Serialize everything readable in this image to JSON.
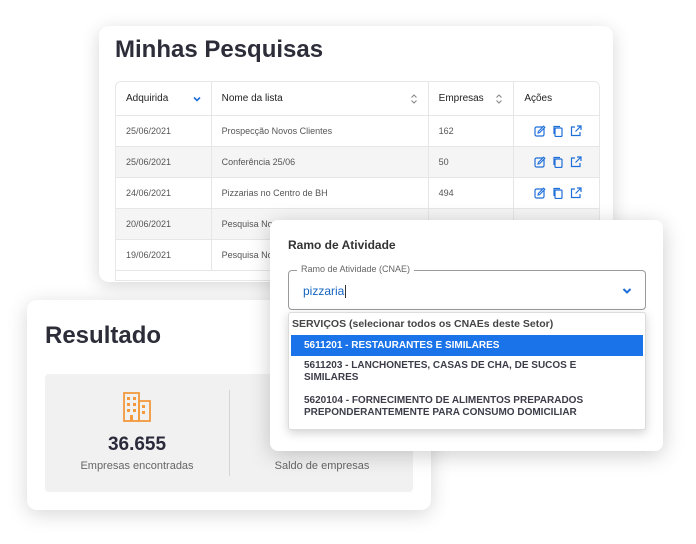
{
  "pesquisas": {
    "title": "Minhas Pesquisas",
    "columns": {
      "adquirida": "Adquirida",
      "nome": "Nome da lista",
      "empresas": "Empresas",
      "acoes": "Ações"
    },
    "rows": [
      {
        "date": "25/06/2021",
        "name": "Prospecção Novos Clientes",
        "count": "162"
      },
      {
        "date": "25/06/2021",
        "name": "Conferência 25/06",
        "count": "50"
      },
      {
        "date": "24/06/2021",
        "name": "Pizzarias no Centro de BH",
        "count": "494"
      },
      {
        "date": "20/06/2021",
        "name": "Pesquisa No",
        "count": ""
      },
      {
        "date": "19/06/2021",
        "name": "Pesquisa No",
        "count": ""
      }
    ],
    "action_icons": [
      "edit-icon",
      "copy-icon",
      "open-external-icon"
    ]
  },
  "resultado": {
    "title": "Resultado",
    "left_stat": {
      "value": "36.655",
      "label": "Empresas encontradas",
      "icon": "building-icon"
    },
    "right_stat": {
      "value": "",
      "label": "Saldo de empresas"
    }
  },
  "ramo": {
    "title": "Ramo de Atividade",
    "field_label": "Ramo de Atividade (CNAE)",
    "field_value": "pizzaria",
    "group_label": "SERVIÇOS (selecionar todos os CNAEs deste Setor)",
    "options": [
      {
        "line1": "5611201 - RESTAURANTES E SIMILARES",
        "line2": "",
        "selected": true
      },
      {
        "line1": "5611203 - LANCHONETES, CASAS DE CHA, DE SUCOS E",
        "line2": "SIMILARES",
        "selected": false
      },
      {
        "line1": "5620104 - FORNECIMENTO DE ALIMENTOS PREPARADOS",
        "line2": "PREPONDERANTEMENTE PARA CONSUMO DOMICILIAR",
        "selected": false
      }
    ]
  },
  "colors": {
    "accent_blue": "#1a73e8",
    "icon_blue": "#1e6fd9",
    "building_orange": "#f39a3d",
    "title_dark": "#2d2d3a"
  }
}
